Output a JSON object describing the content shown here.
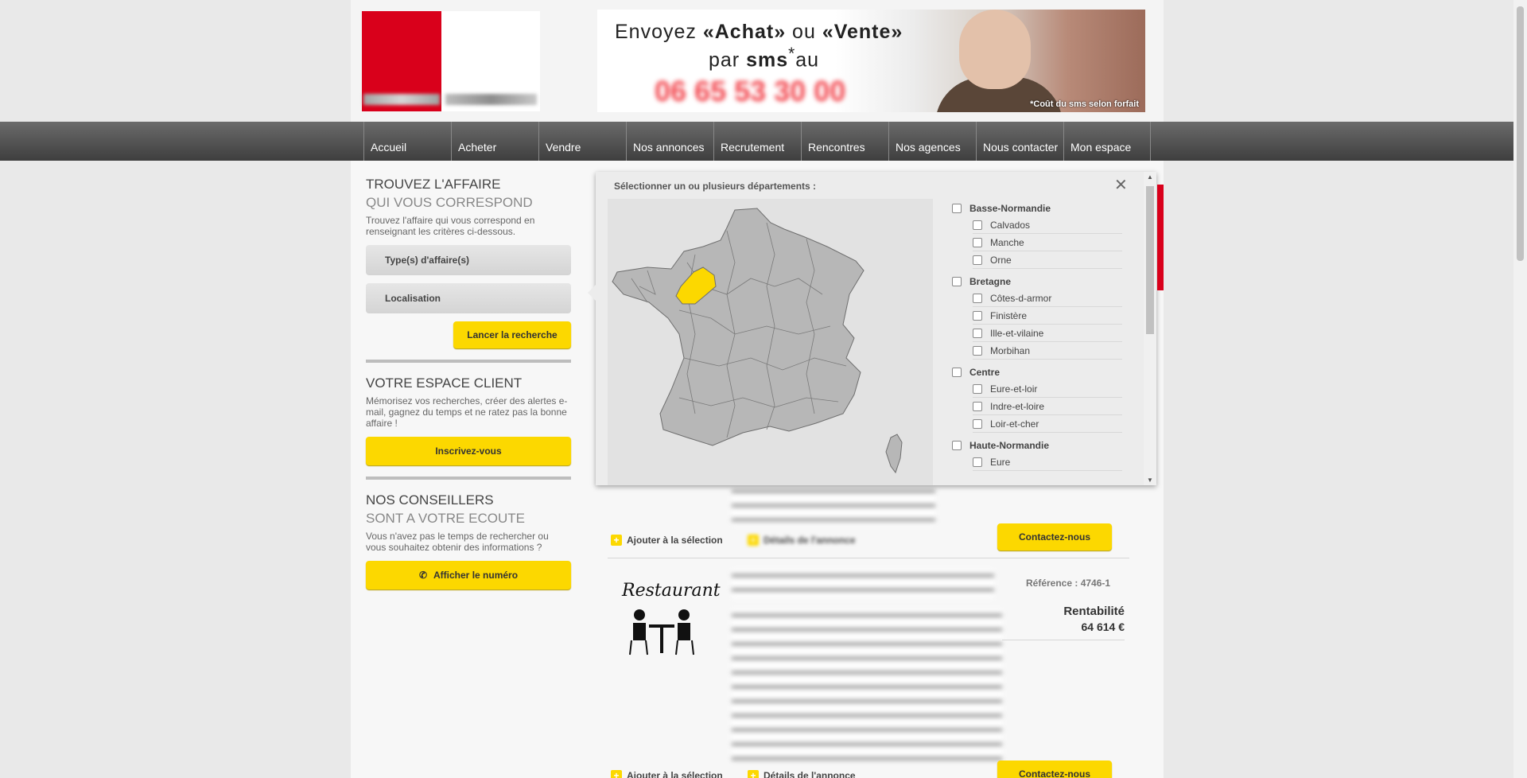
{
  "banner": {
    "line1_prefix": "Envoyez ",
    "line1_achat": "«Achat»",
    "line1_mid": " ou ",
    "line1_vente": "«Vente»",
    "line2_prefix": "par ",
    "line2_sms": "sms",
    "line2_star": "*",
    "line2_suffix": "au",
    "phone": "06 65 53 30 00",
    "note": "*Coût du sms selon forfait"
  },
  "nav": {
    "items": [
      "Accueil",
      "Acheter",
      "Vendre",
      "Nos annonces",
      "Recrutement",
      "Rencontres",
      "Nos agences",
      "Nous contacter",
      "Mon espace"
    ]
  },
  "search": {
    "title": "TROUVEZ L'AFFAIRE",
    "subtitle": "QUI VOUS CORRESPOND",
    "desc": "Trouvez l'affaire qui vous correspond en renseignant les critères ci-dessous.",
    "type_field": "Type(s) d'affaire(s)",
    "location_field": "Localisation",
    "search_button": "Lancer la recherche"
  },
  "client": {
    "title": "VOTRE ESPACE CLIENT",
    "desc": "Mémorisez vos recherches, créer des alertes e-mail, gagnez du temps et ne ratez pas la bonne affaire !",
    "button": "Inscrivez-vous"
  },
  "advisors": {
    "title": "NOS CONSEILLERS",
    "subtitle": "SONT A VOTRE ECOUTE",
    "desc": "Vous n'avez pas le temps de rechercher ou vous souhaitez obtenir des informations ?",
    "button": "Afficher le numéro"
  },
  "overlay": {
    "title": "Sélectionner un ou plusieurs départements :",
    "close": "✕",
    "regions": [
      {
        "name": "Basse-Normandie",
        "depts": [
          "Calvados",
          "Manche",
          "Orne"
        ]
      },
      {
        "name": "Bretagne",
        "depts": [
          "Côtes-d-armor",
          "Finistère",
          "Ille-et-vilaine",
          "Morbihan"
        ]
      },
      {
        "name": "Centre",
        "depts": [
          "Eure-et-loir",
          "Indre-et-loire",
          "Loir-et-cher"
        ]
      },
      {
        "name": "Haute-Normandie",
        "depts": [
          "Eure"
        ]
      }
    ],
    "highlight_color": "#fcd800",
    "map_color": "#b7b7b7"
  },
  "listings": {
    "add_selection": "Ajouter à la sélection",
    "details": "Détails de l'annonce",
    "contact": "Contactez-nous",
    "reference": "Référence : 4746-1",
    "rentability_label": "Rentabilité",
    "rentability_value": "64 614 €",
    "restaurant_label": "Restaurant"
  }
}
